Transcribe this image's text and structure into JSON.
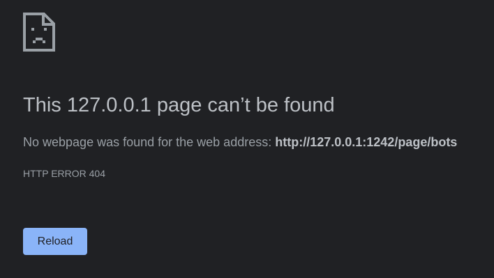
{
  "icon": "sad-page-icon",
  "title": "This 127.0.0.1 page can’t be found",
  "message": {
    "prefix": "No webpage was found for the web address: ",
    "url": "http://127.0.0.1:1242/page/bots"
  },
  "error_code": "HTTP ERROR 404",
  "reload_label": "Reload",
  "colors": {
    "background": "#202124",
    "title": "#bdc1c6",
    "text": "#9aa0a6",
    "button": "#8ab4f8"
  }
}
